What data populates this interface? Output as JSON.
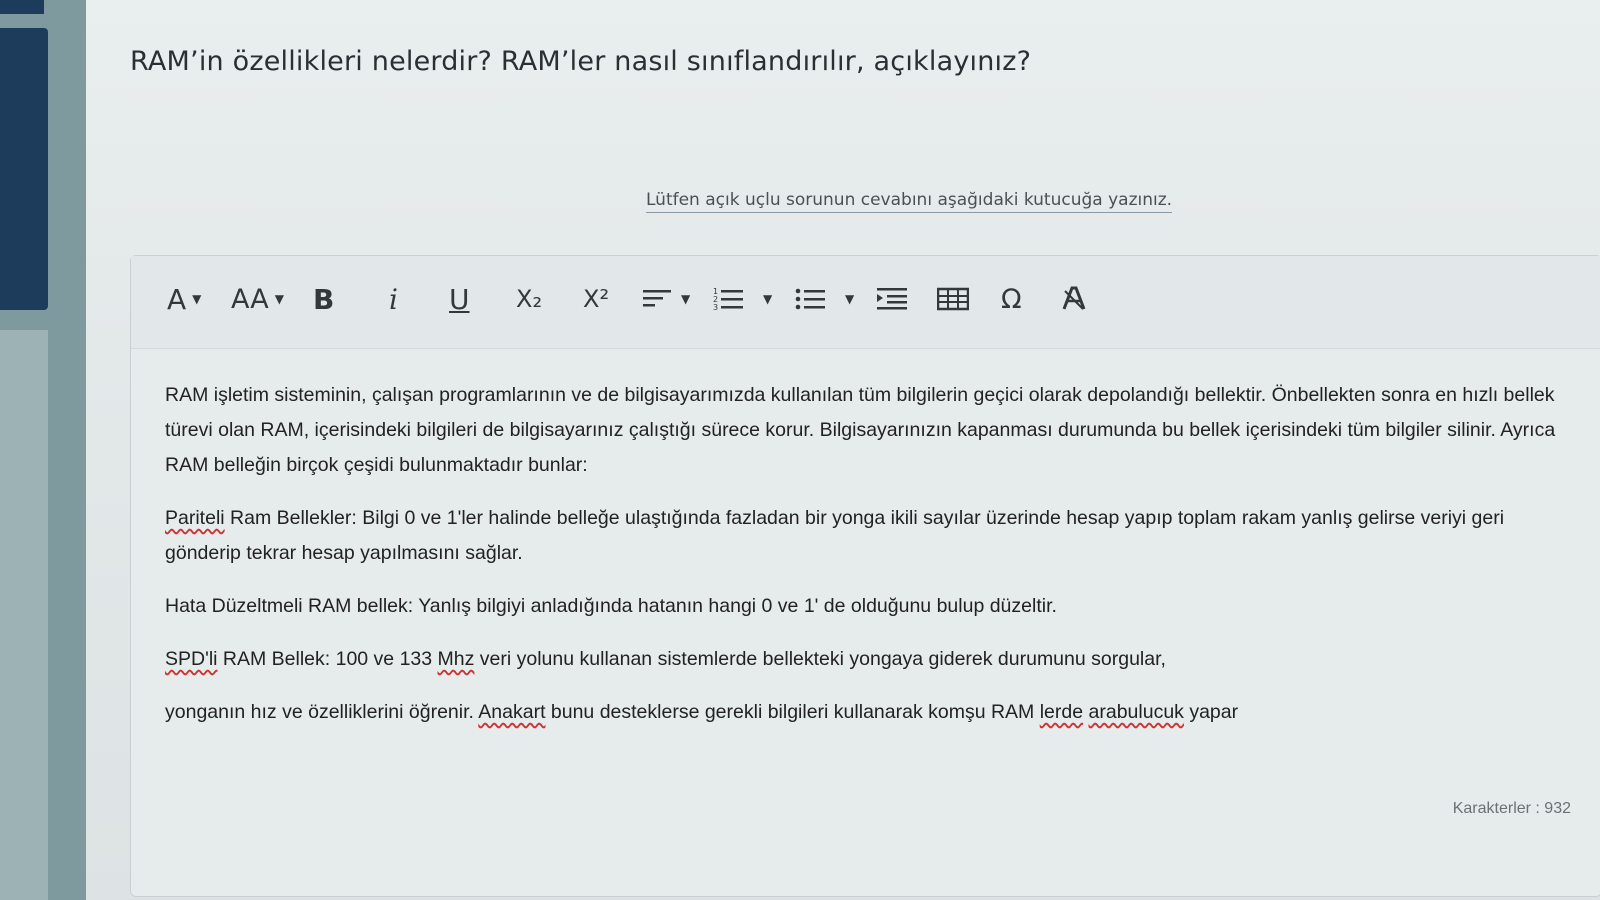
{
  "question": {
    "title": "RAM’in özellikleri nelerdir? RAM’ler nasıl sınıflandırılır, açıklayınız?",
    "instruction": "Lütfen açık uçlu sorunun cevabını aşağıdaki kutucuğa yazınız."
  },
  "toolbar": {
    "font_color": "A",
    "font_size": "AA",
    "bold": "B",
    "italic": "i",
    "underline": "U",
    "subscript": "X₂",
    "superscript": "X²",
    "special_char": "Ω"
  },
  "content": {
    "p1": "RAM işletim sisteminin, çalışan programlarının ve de bilgisayarımızda kullanılan tüm bilgilerin geçici olarak depolandığı bellektir. Önbellekten sonra en hızlı bellek türevi olan RAM, içerisindeki bilgileri de bilgisayarınız çalıştığı sürece korur. Bilgisayarınızın kapanması durumunda bu bellek içerisindeki tüm bilgiler silinir. Ayrıca RAM belleğin birçok çeşidi bulunmaktadır bunlar:",
    "p2_a": "Pariteli",
    "p2_b": " Ram Bellekler: Bilgi 0 ve 1'ler halinde belleğe ulaştığında fazladan bir yonga ikili sayılar üzerinde hesap yapıp toplam rakam yanlış gelirse veriyi geri gönderip tekrar hesap yapılmasını sağlar.",
    "p3": "Hata Düzeltmeli RAM bellek: Yanlış bilgiyi anladığında hatanın hangi 0 ve 1' de olduğunu bulup düzeltir.",
    "p4_a": "SPD'li",
    "p4_b": " RAM Bellek: 100 ve 133 ",
    "p4_c": "Mhz",
    "p4_d": " veri yolunu kullanan sistemlerde bellekteki yongaya giderek durumunu sorgular,",
    "p5_a": "yonganın hız ve özelliklerini öğrenir. ",
    "p5_b": "Anakart",
    "p5_c": " bunu desteklerse gerekli bilgileri kullanarak komşu RAM ",
    "p5_d": "lerde",
    "p5_e": " ",
    "p5_f": "arabulucuk",
    "p5_g": " yapar"
  },
  "counter": "Karakterler : 932",
  "colors": {
    "sidebar_dark": "#1d3c5c",
    "spellcheck": "#cc3333"
  },
  "icons": [
    "chevron-down-icon",
    "align-icon",
    "ordered-list-icon",
    "unordered-list-icon",
    "indent-icon",
    "table-icon",
    "clear-format-icon"
  ]
}
